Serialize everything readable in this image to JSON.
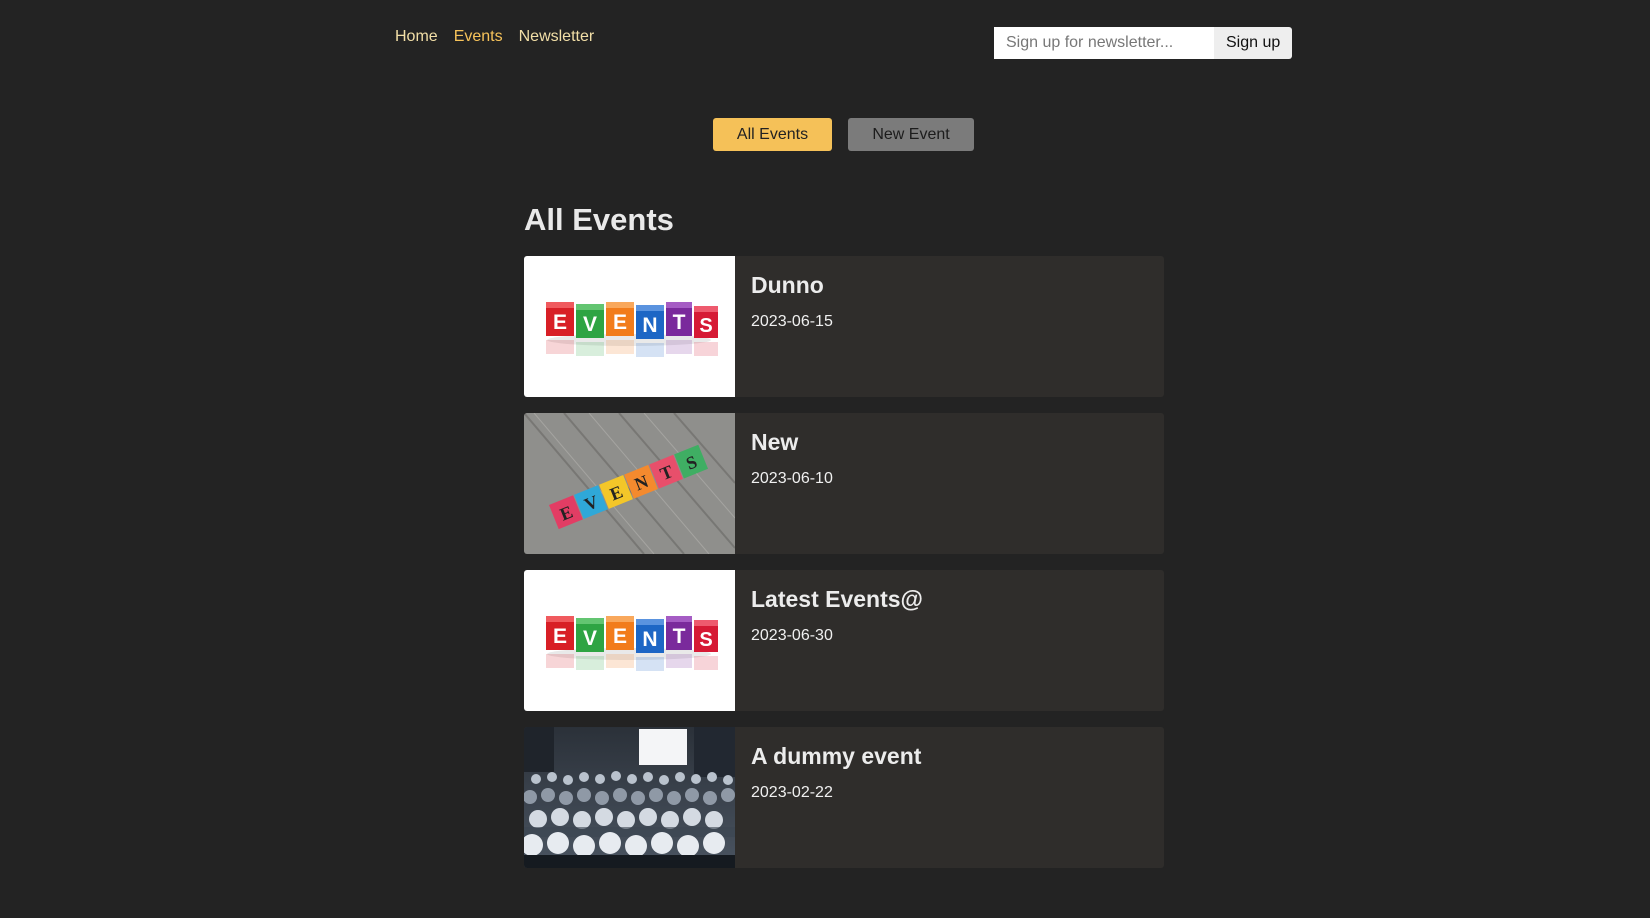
{
  "nav": {
    "items": [
      {
        "label": "Home"
      },
      {
        "label": "Events"
      },
      {
        "label": "Newsletter"
      }
    ],
    "active_index": 1
  },
  "newsletter": {
    "placeholder": "Sign up for newsletter...",
    "value": "",
    "button_label": "Sign up"
  },
  "events_nav": {
    "all_label": "All Events",
    "new_label": "New Event"
  },
  "page": {
    "heading": "All Events"
  },
  "events": [
    {
      "title": "Dunno",
      "date": "2023-06-15",
      "image": "events-cubes-white"
    },
    {
      "title": "New",
      "date": "2023-06-10",
      "image": "events-cubes-wood"
    },
    {
      "title": "Latest Events@",
      "date": "2023-06-30",
      "image": "events-cubes-white"
    },
    {
      "title": "A dummy event",
      "date": "2023-02-22",
      "image": "audience-photo"
    }
  ],
  "colors": {
    "background": "#232323",
    "accent": "#f5c158",
    "card": "#2f2d2b"
  }
}
